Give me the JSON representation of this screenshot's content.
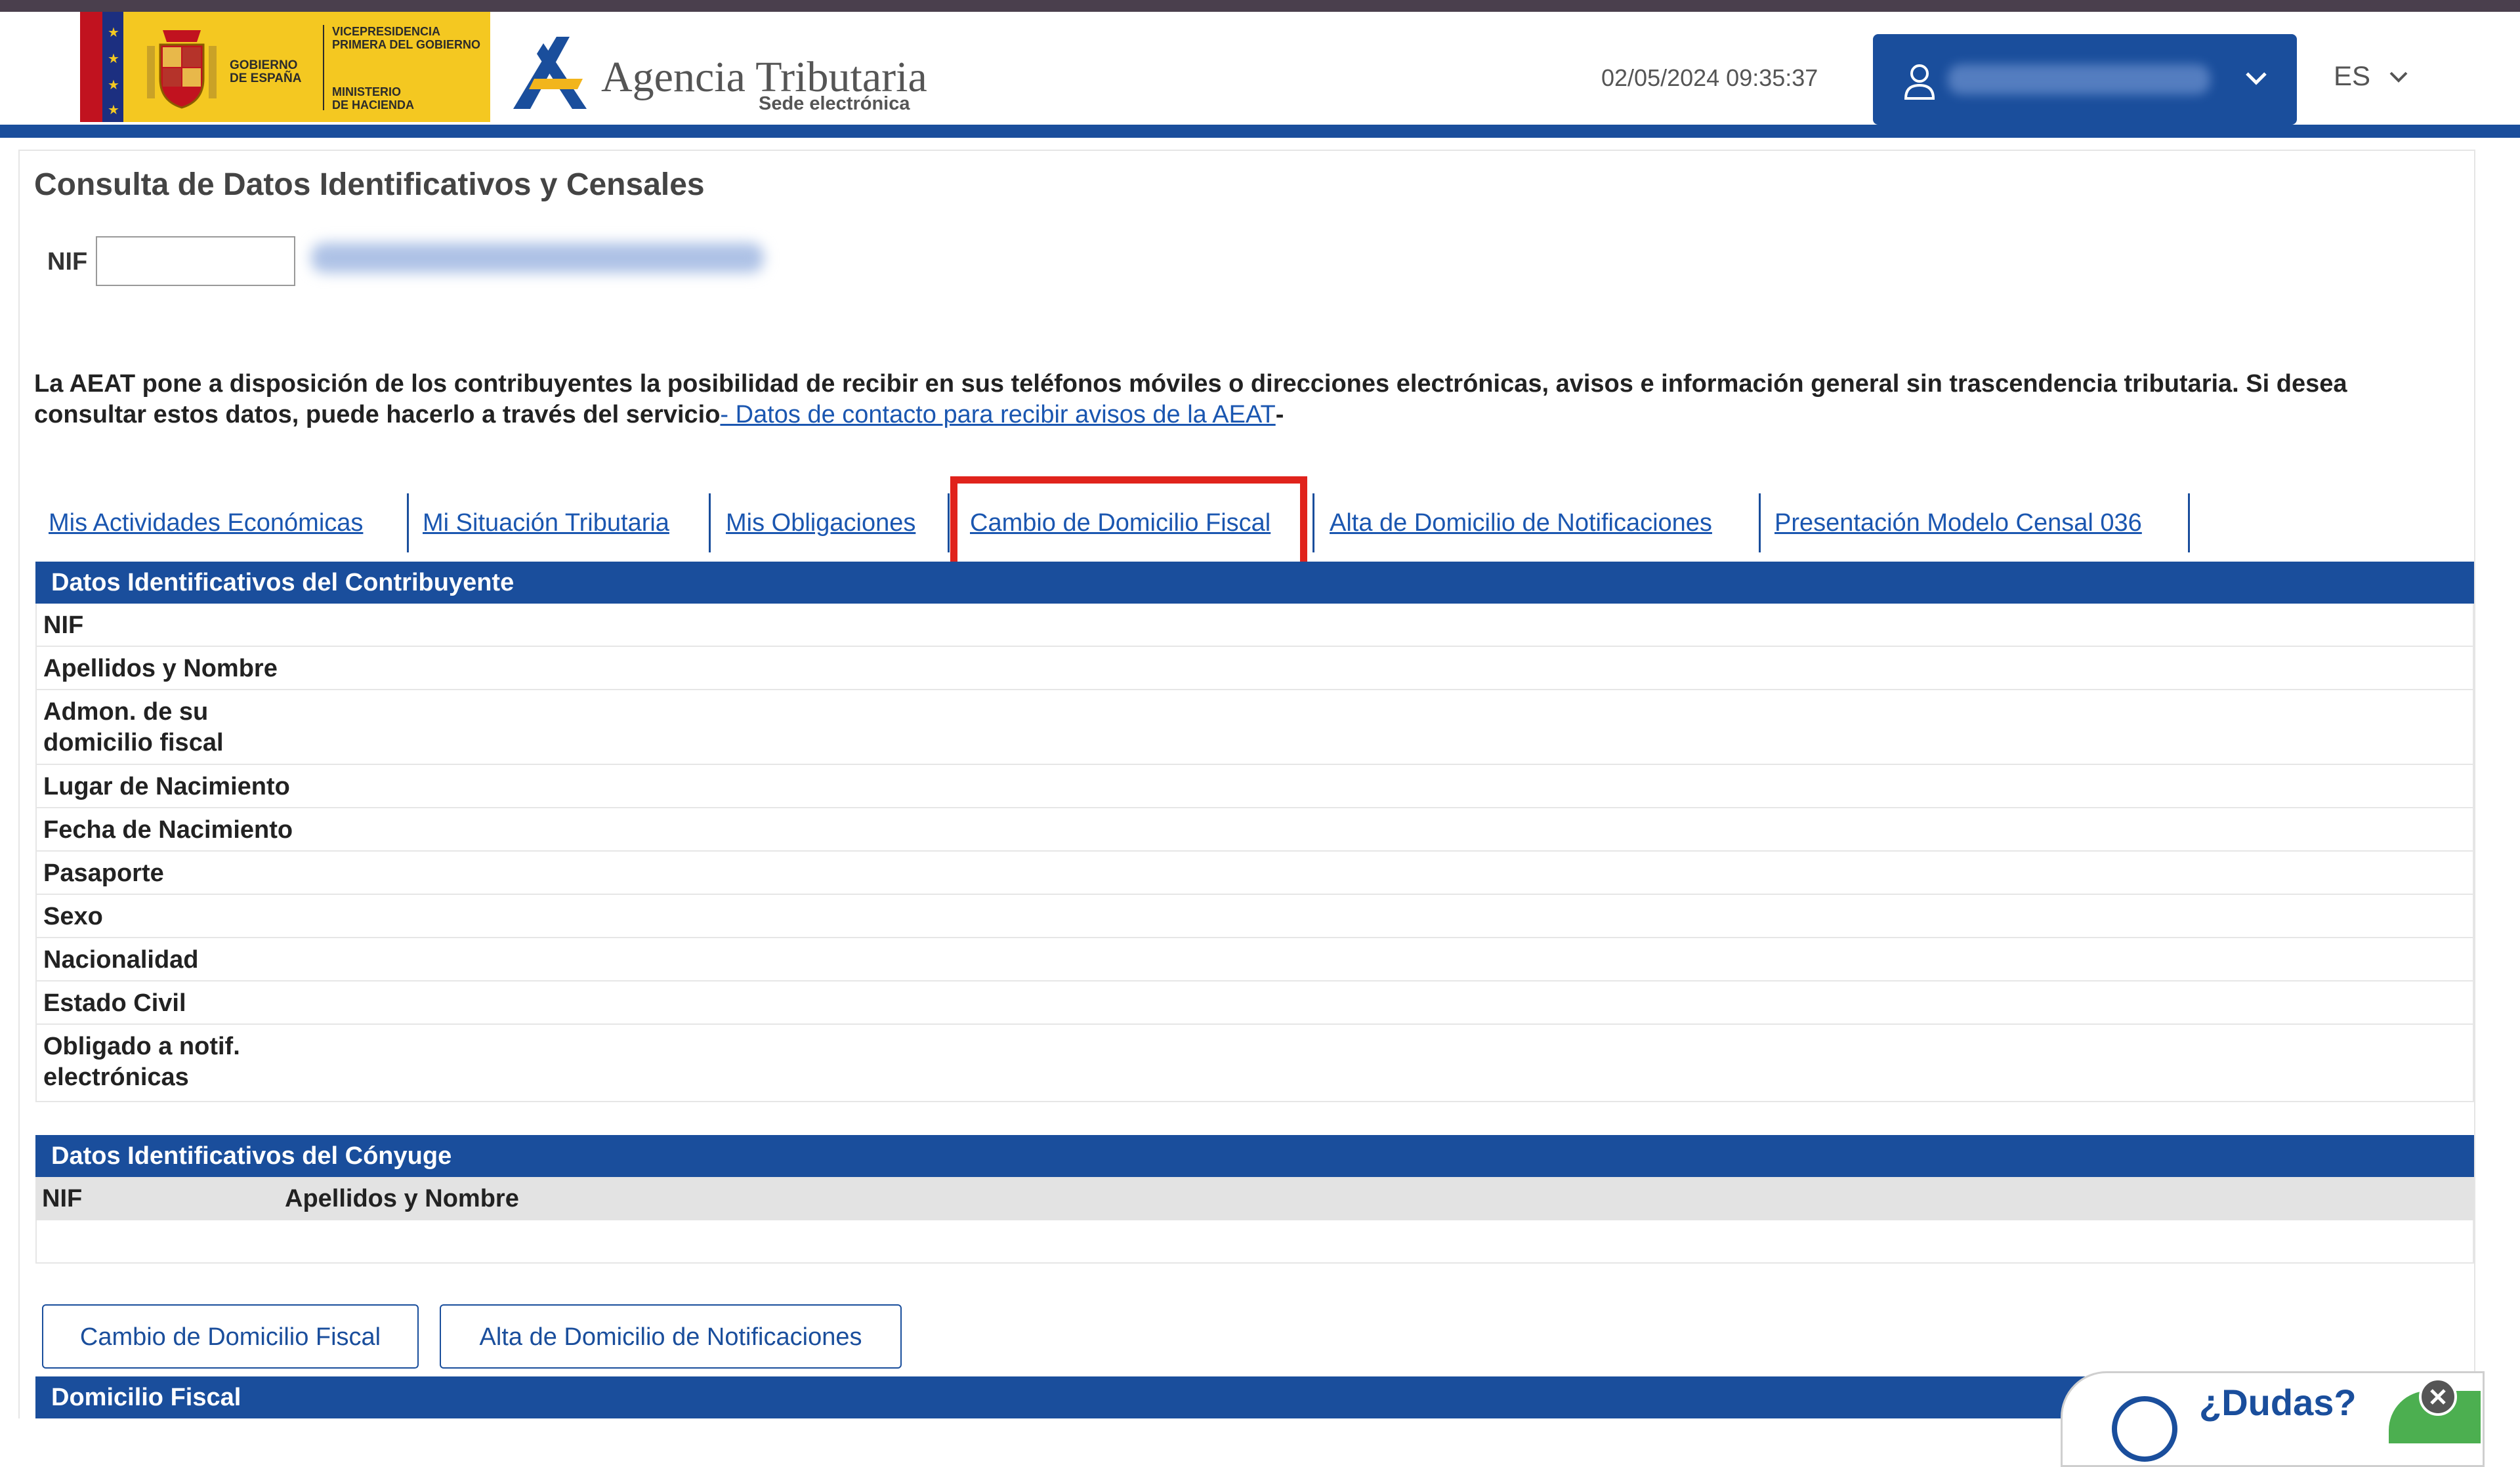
{
  "header": {
    "gov_text": {
      "line1": "GOBIERNO",
      "line2": "DE ESPAÑA",
      "vp_line1": "VICEPRESIDENCIA",
      "vp_line2": "PRIMERA DEL GOBIERNO",
      "min_line1": "MINISTERIO",
      "min_line2": "DE HACIENDA"
    },
    "agency_title": "Agencia Tributaria",
    "agency_subtitle": "Sede electrónica",
    "datetime": "02/05/2024 09:35:37",
    "language": "ES"
  },
  "page": {
    "title": "Consulta de Datos Identificativos y Censales",
    "nif_label": "NIF",
    "nif_value": ""
  },
  "notice": {
    "text": "La AEAT pone a disposición de los contribuyentes la posibilidad de recibir en sus teléfonos móviles o direcciones electrónicas, avisos e información general sin trascendencia tributaria. Si desea consultar estos datos, puede hacerlo a través del servicio",
    "link_text": "- Datos de contacto para recibir avisos de la AEAT",
    "trailing": "-"
  },
  "tabs": [
    {
      "label": "Mis Actividades Económicas"
    },
    {
      "label": "Mi Situación Tributaria"
    },
    {
      "label": "Mis Obligaciones"
    },
    {
      "label": "Cambio de Domicilio Fiscal"
    },
    {
      "label": "Alta de Domicilio de Notificaciones"
    },
    {
      "label": "Presentación Modelo Censal 036"
    }
  ],
  "taxpayer": {
    "heading": "Datos Identificativos del Contribuyente",
    "rows": [
      {
        "label": "NIF"
      },
      {
        "label": "Apellidos y Nombre"
      },
      {
        "label": "Admon. de su domicilio fiscal"
      },
      {
        "label": "Lugar de Nacimiento"
      },
      {
        "label": "Fecha de Nacimiento"
      },
      {
        "label": "Pasaporte"
      },
      {
        "label": "Sexo"
      },
      {
        "label": "Nacionalidad"
      },
      {
        "label": "Estado Civil"
      },
      {
        "label": "Obligado a notif. electrónicas"
      }
    ]
  },
  "spouse": {
    "heading": "Datos Identificativos del Cónyuge",
    "col_nif": "NIF",
    "col_name": "Apellidos y Nombre"
  },
  "buttons": {
    "change_address": "Cambio de Domicilio Fiscal",
    "add_notification_address": "Alta de Domicilio de Notificaciones"
  },
  "fiscal_address": {
    "heading": "Domicilio Fiscal"
  },
  "widget": {
    "label": "¿Dudas?"
  },
  "colors": {
    "brand_blue": "#1a4e9c",
    "link_blue": "#1a56b0",
    "highlight_red": "#e0231c"
  }
}
